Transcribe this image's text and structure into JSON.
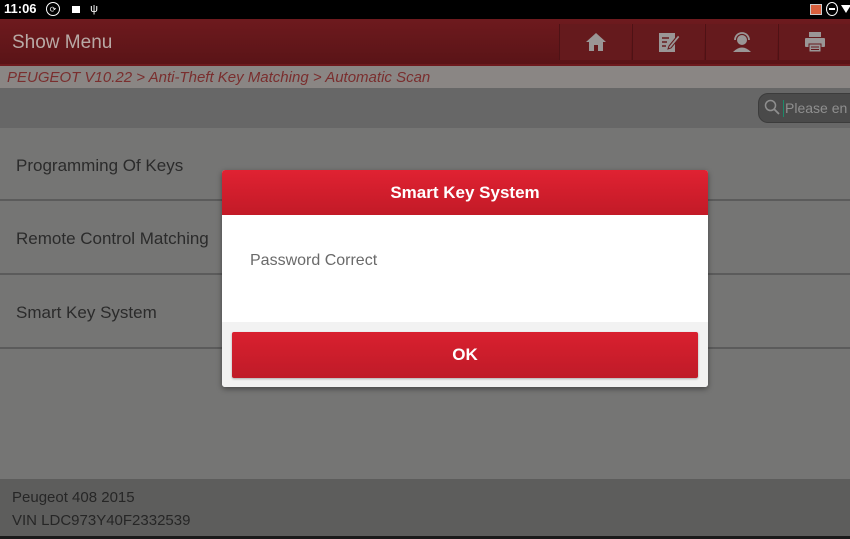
{
  "statusbar": {
    "time": "11:06",
    "icons": [
      "sync-icon",
      "video-icon",
      "usb-debug-icon",
      "cast-icon",
      "do-not-disturb-icon",
      "wifi-icon"
    ]
  },
  "appbar": {
    "title": "Show Menu",
    "buttons": [
      {
        "name": "home",
        "icon": "home-icon"
      },
      {
        "name": "edit",
        "icon": "edit-icon"
      },
      {
        "name": "support",
        "icon": "support-headset-icon"
      },
      {
        "name": "print",
        "icon": "printer-icon"
      }
    ]
  },
  "breadcrumb": {
    "text": "PEUGEOT V10.22 > Anti-Theft Key Matching > Automatic Scan"
  },
  "search": {
    "placeholder": "Please en"
  },
  "menu": {
    "items": [
      {
        "label": "Programming Of Keys"
      },
      {
        "label": "Remote Control Matching"
      },
      {
        "label": "Smart Key System"
      }
    ]
  },
  "footer": {
    "vehicle": "Peugeot 408 2015",
    "vin": "VIN LDC973Y40F2332539"
  },
  "dialog": {
    "title": "Smart Key System",
    "message": "Password Correct",
    "ok_label": "OK"
  },
  "colors": {
    "accent_red": "#d9202f",
    "appbar_dark_red": "#6e1a1e",
    "breadcrumb_text": "#7a2e2e"
  }
}
